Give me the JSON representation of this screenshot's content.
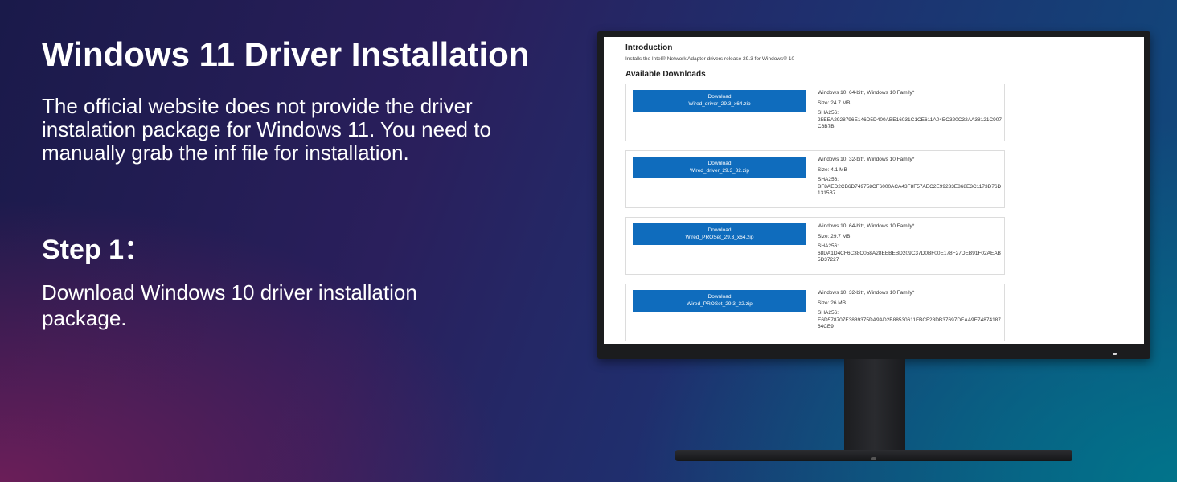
{
  "hero": {
    "title": "Windows 11 Driver Installation",
    "intro": "The official website does not provide the driver instalation package for Windows 11. You need to manually grab the inf file for installation.",
    "step_title": "Step 1：",
    "step_description": "Download Windows 10 driver installation package."
  },
  "screen": {
    "heading": "Introduction",
    "subheading": "Installs the Intel® Network Adapter drivers release 29.3 for Windows® 10",
    "section_heading": "Available Downloads",
    "downloads": [
      {
        "button_label": "Download",
        "file_name": "Wired_driver_29.3_x64.zip",
        "os": "Windows 10, 64-bit*, Windows 10 Family*",
        "size": "Size: 24.7 MB",
        "sha_label": "SHA256:",
        "sha": "25EEA2928796E146D5D400ABE16031C1CE611A04EC320C32AA38121C907C6B7B"
      },
      {
        "button_label": "Download",
        "file_name": "Wired_driver_29.3_32.zip",
        "os": "Windows 10, 32-bit*, Windows 10 Family*",
        "size": "Size: 4.1 MB",
        "sha_label": "SHA256:",
        "sha": "BF8AED2CB6D749758CF6000ACA43F8F57AEC2E99233E868E3C1173D76D1315B7"
      },
      {
        "button_label": "Download",
        "file_name": "Wired_PROSet_29.3_x64.zip",
        "os": "Windows 10, 64-bit*, Windows 10 Family*",
        "size": "Size: 29.7 MB",
        "sha_label": "SHA256:",
        "sha": "68DA1D4CF6C38C058A28EEBEBD209C37D0BF00E178F27DEB91F02AEAB5D37227"
      },
      {
        "button_label": "Download",
        "file_name": "Wired_PROSet_29.3_32.zip",
        "os": "Windows 10, 32-bit*, Windows 10 Family*",
        "size": "Size: 26 MB",
        "sha_label": "SHA256:",
        "sha": "E6D578707E3889375DA9AD2B88530611FBCF28DB37697DEAA9E7487418764CE9"
      }
    ]
  },
  "colors": {
    "download_button": "#0f6cbd",
    "monitor_bezel": "#1b1c1e"
  }
}
